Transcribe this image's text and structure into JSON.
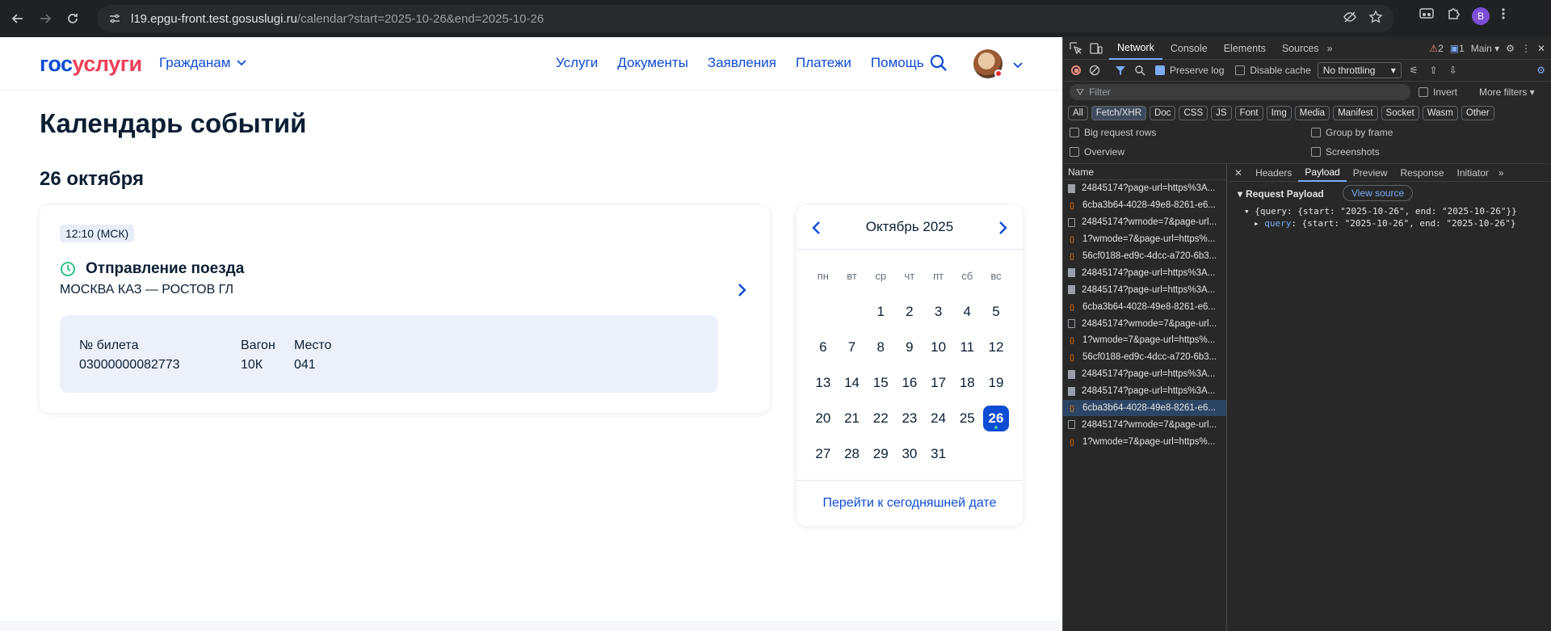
{
  "browser": {
    "url_host": "l19.epgu-front.test.gosuslugi.ru",
    "url_path": "/calendar?start=2025-10-26&end=2025-10-26",
    "profile_initial": "B"
  },
  "site": {
    "logo_part1": "гос",
    "logo_part2": "услуги",
    "citizens_label": "Гражданам",
    "nav": [
      "Услуги",
      "Документы",
      "Заявления",
      "Платежи",
      "Помощь"
    ]
  },
  "page": {
    "title": "Календарь событий",
    "date_heading": "26 октября"
  },
  "event": {
    "time": "12:10 (МСК)",
    "title": "Отправление поезда",
    "route": "МОСКВА КАЗ — РОСТОВ ГЛ",
    "ticket_label": "№ билета",
    "ticket_value": "03000000082773",
    "wagon_label": "Вагон",
    "wagon_value": "10К",
    "seat_label": "Место",
    "seat_value": "041"
  },
  "calendar": {
    "month": "Октябрь 2025",
    "weekdays": [
      "пн",
      "вт",
      "ср",
      "чт",
      "пт",
      "сб",
      "вс"
    ],
    "days": [
      "",
      "",
      "1",
      "2",
      "3",
      "4",
      "5",
      "6",
      "7",
      "8",
      "9",
      "10",
      "11",
      "12",
      "13",
      "14",
      "15",
      "16",
      "17",
      "18",
      "19",
      "20",
      "21",
      "22",
      "23",
      "24",
      "25",
      "26",
      "27",
      "28",
      "29",
      "30",
      "31"
    ],
    "selected_day": "26",
    "today_link": "Перейти к сегодняшней дате"
  },
  "devtools": {
    "tabs": [
      "Network",
      "Console",
      "Elements",
      "Sources"
    ],
    "warnings": "2",
    "messages": "1",
    "context": "Main",
    "preserve_log": "Preserve log",
    "disable_cache": "Disable cache",
    "throttling": "No throttling",
    "filter_placeholder": "Filter",
    "invert": "Invert",
    "more_filters": "More filters",
    "type_chips": [
      "All",
      "Fetch/XHR",
      "Doc",
      "CSS",
      "JS",
      "Font",
      "Img",
      "Media",
      "Manifest",
      "Socket",
      "Wasm",
      "Other"
    ],
    "big_rows": "Big request rows",
    "group_frame": "Group by frame",
    "overview": "Overview",
    "screenshots": "Screenshots",
    "name_col": "Name",
    "requests": [
      {
        "name": "24845174?page-url=https%3A...",
        "icon": "doc-filled"
      },
      {
        "name": "6cba3b64-4028-49e8-8261-e6...",
        "icon": "xhr"
      },
      {
        "name": "24845174?wmode=7&page-url...",
        "icon": "doc"
      },
      {
        "name": "1?wmode=7&page-url=https%...",
        "icon": "xhr"
      },
      {
        "name": "56cf0188-ed9c-4dcc-a720-6b3...",
        "icon": "xhr"
      },
      {
        "name": "24845174?page-url=https%3A...",
        "icon": "doc-filled"
      },
      {
        "name": "24845174?page-url=https%3A...",
        "icon": "doc-filled"
      },
      {
        "name": "6cba3b64-4028-49e8-8261-e6...",
        "icon": "xhr"
      },
      {
        "name": "24845174?wmode=7&page-url...",
        "icon": "doc"
      },
      {
        "name": "1?wmode=7&page-url=https%...",
        "icon": "xhr"
      },
      {
        "name": "56cf0188-ed9c-4dcc-a720-6b3...",
        "icon": "xhr"
      },
      {
        "name": "24845174?page-url=https%3A...",
        "icon": "doc-filled"
      },
      {
        "name": "24845174?page-url=https%3A...",
        "icon": "doc-filled"
      },
      {
        "name": "6cba3b64-4028-49e8-8261-e6...",
        "icon": "xhr"
      },
      {
        "name": "24845174?wmode=7&page-url...",
        "icon": "doc"
      },
      {
        "name": "1?wmode=7&page-url=https%...",
        "icon": "xhr"
      }
    ],
    "selected_request": 13,
    "detail_tabs": [
      "Headers",
      "Payload",
      "Preview",
      "Response",
      "Initiator"
    ],
    "active_detail_tab": "Payload",
    "payload_title": "Request Payload",
    "view_source": "View source",
    "payload_line1": "{query: {start: \"2025-10-26\", end: \"2025-10-26\"}}",
    "payload_key": "query",
    "payload_line2": ": {start: \"2025-10-26\", end: \"2025-10-26\"}"
  },
  "colors": {
    "brand_blue": "#0d4cd3",
    "brand_red": "#ee3f58",
    "selected_day_bg": "#0d4cd3",
    "ticket_bg": "#ecf0f8",
    "devtools_bg": "#282828"
  }
}
